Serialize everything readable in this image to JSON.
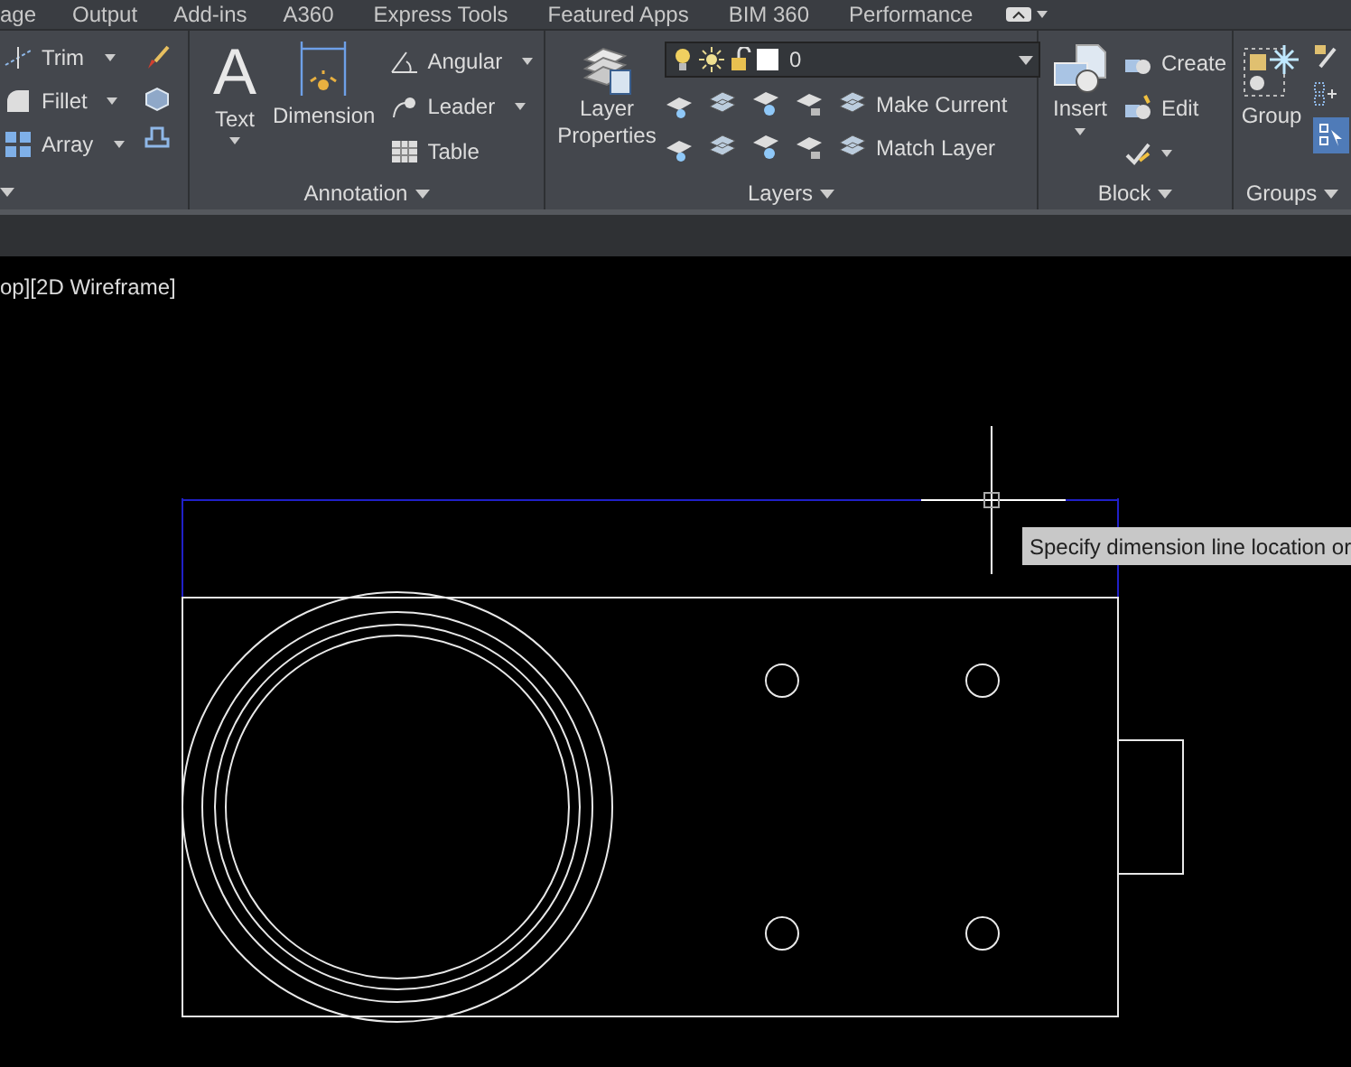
{
  "ribbon_tabs": [
    {
      "label": "age"
    },
    {
      "label": "Output"
    },
    {
      "label": "Add-ins"
    },
    {
      "label": "A360"
    },
    {
      "label": "Express Tools"
    },
    {
      "label": "Featured Apps"
    },
    {
      "label": "BIM 360"
    },
    {
      "label": "Performance"
    }
  ],
  "modify_panel": {
    "tools": [
      "Trim",
      "Fillet",
      "Array"
    ]
  },
  "annotation_panel": {
    "title": "Annotation",
    "text_glyph": "A",
    "large_tools": [
      "Text",
      "Dimension"
    ],
    "tools": [
      "Angular",
      "Leader",
      "Table"
    ]
  },
  "layers_panel": {
    "title": "Layers",
    "large_tool": "Layer Properties",
    "layer_dropdown": {
      "value": "0"
    },
    "tools": [
      "Make Current",
      "Match Layer"
    ]
  },
  "block_panel": {
    "title": "Block",
    "large_tool": "Insert",
    "tools": [
      "Create",
      "Edit"
    ]
  },
  "groups_panel": {
    "title": "Groups",
    "large_tool": "Group"
  },
  "viewport_label": "op][2D Wireframe]",
  "tooltip": "Specify dimension line location or"
}
